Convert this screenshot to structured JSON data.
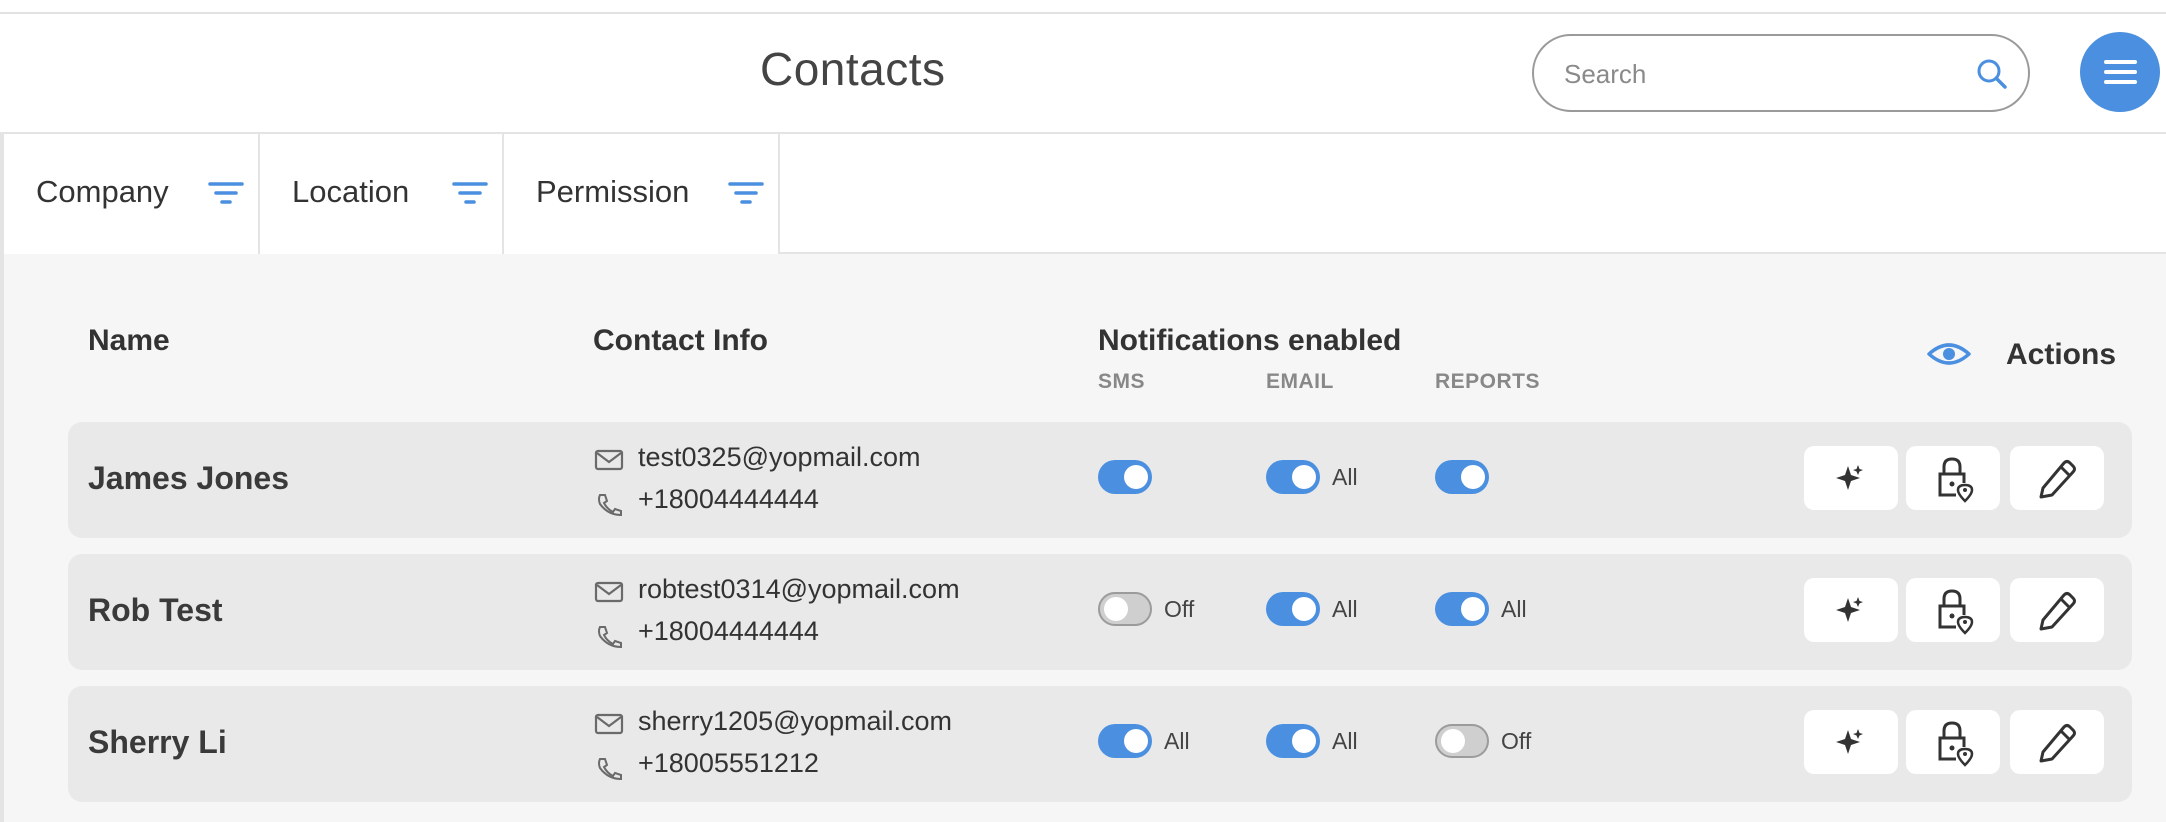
{
  "header": {
    "title": "Contacts",
    "search_placeholder": "Search",
    "search_value": ""
  },
  "filters": [
    {
      "label": "Company"
    },
    {
      "label": "Location"
    },
    {
      "label": "Permission"
    }
  ],
  "table": {
    "columns": {
      "name": "Name",
      "contact_info": "Contact Info",
      "notifications": "Notifications enabled",
      "actions": "Actions"
    },
    "sub_columns": {
      "sms": "SMS",
      "email": "EMAIL",
      "reports": "REPORTS"
    },
    "rows": [
      {
        "name": "James Jones",
        "email": "test0325@yopmail.com",
        "phone": "+18004444444",
        "sms": {
          "on": true,
          "label": ""
        },
        "email_notif": {
          "on": true,
          "label": "All"
        },
        "reports": {
          "on": true,
          "label": ""
        }
      },
      {
        "name": "Rob Test",
        "email": "robtest0314@yopmail.com",
        "phone": "+18004444444",
        "sms": {
          "on": false,
          "label": "Off"
        },
        "email_notif": {
          "on": true,
          "label": "All"
        },
        "reports": {
          "on": true,
          "label": "All"
        }
      },
      {
        "name": "Sherry Li",
        "email": "sherry1205@yopmail.com",
        "phone": "+18005551212",
        "sms": {
          "on": true,
          "label": "All"
        },
        "email_notif": {
          "on": true,
          "label": "All"
        },
        "reports": {
          "on": false,
          "label": "Off"
        }
      }
    ]
  },
  "icons": {
    "search": "search-icon",
    "menu": "hamburger-menu-icon",
    "filter": "filter-icon",
    "visibility": "eye-icon",
    "email": "envelope-icon",
    "phone": "phone-icon",
    "sparkle": "sparkle-icon",
    "lock_location": "lock-location-icon",
    "edit": "pencil-icon"
  },
  "colors": {
    "accent": "#4a8fe0",
    "toggle_off": "#cfcfcf",
    "row_bg": "#e9e9e9",
    "content_bg": "#f6f6f6"
  }
}
